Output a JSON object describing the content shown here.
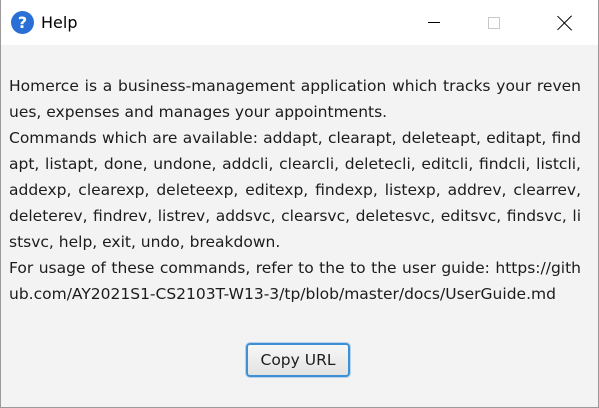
{
  "window": {
    "title": "Help",
    "icon": "help-question-icon",
    "controls": {
      "minimize": "minimize-icon",
      "maximize": "maximize-icon",
      "close": "close-icon"
    }
  },
  "help": {
    "description": "Homerce is a business-management application which tracks your revenues, expenses and manages your appointments.",
    "commands": "Commands which are available: addapt, clearapt, deleteapt, editapt, findapt, listapt, done, undone, addcli, clearcli, deletecli, editcli, findcli, listcli, addexp, clearexp, deleteexp, editexp, findexp, listexp, addrev, clearrev, deleterev, findrev, listrev, addsvc, clearsvc, deletesvc, editsvc, findsvc, listsvc, help, exit, undo, breakdown.",
    "usage": "For usage of these commands, refer to the to the user guide: https://github.com/AY2021S1-CS2103T-W13-3/tp/blob/master/docs/UserGuide.md"
  },
  "actions": {
    "copy_url_label": "Copy URL"
  },
  "colors": {
    "accent": "#3f8fd3",
    "help_icon": "#2a6fd6",
    "background": "#f3f3f3",
    "titlebar": "#ffffff"
  }
}
